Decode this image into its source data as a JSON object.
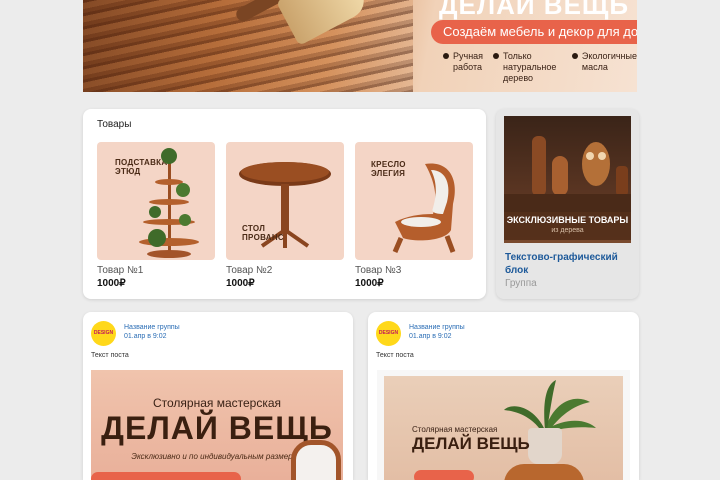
{
  "banner": {
    "title_partial": "ДЕЛАЙ ВЕЩЬ",
    "subtitle": "Создаём мебель и декор для дома",
    "features": [
      {
        "line1": "Ручная",
        "line2": "работа"
      },
      {
        "line1": "Только натуральное",
        "line2": "дерево"
      },
      {
        "line1": "Экологичные",
        "line2": "масла"
      }
    ]
  },
  "products": {
    "header": "Товары",
    "items": [
      {
        "image_label_1": "ПОДСТАВКА",
        "image_label_2": "ЭТЮД",
        "name": "Товар №1",
        "price": "1000₽"
      },
      {
        "image_label_1": "СТОЛ",
        "image_label_2": "ПРОВАНС",
        "name": "Товар №2",
        "price": "1000₽"
      },
      {
        "image_label_1": "КРЕСЛО",
        "image_label_2": "ЭЛЕГИЯ",
        "name": "Товар №3",
        "price": "1000₽"
      }
    ]
  },
  "promo": {
    "image_title": "ЭКСКЛЮЗИВНЫЕ ТОВАРЫ",
    "image_subtitle": "из дерева",
    "title": "Текстово-графический блок",
    "subtitle": "Группа"
  },
  "posts": [
    {
      "avatar_text": "DESIGN",
      "group_name": "Название группы",
      "date": "01.апр в 9:02",
      "text": "Текст поста",
      "image_line1": "Столярная мастерская",
      "image_line2": "ДЕЛАЙ ВЕЩЬ",
      "image_line3": "Эксклюзивно и по индивидуальным размерам"
    },
    {
      "avatar_text": "DESIGN",
      "group_name": "Название группы",
      "date": "01.апр в 9:02",
      "text": "Текст поста",
      "image_line1": "Столярная мастерская",
      "image_line2": "ДЕЛАЙ ВЕЩЬ"
    }
  ],
  "colors": {
    "accent": "#e8634a",
    "link": "#2a6db5",
    "background": "#ececec"
  }
}
